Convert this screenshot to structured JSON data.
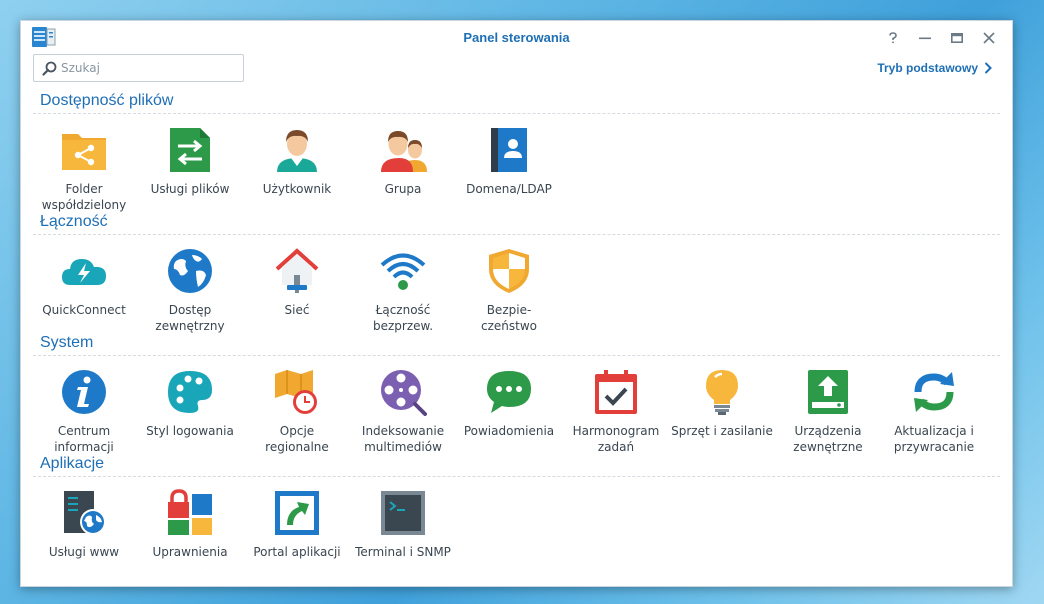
{
  "window": {
    "title": "Panel sterowania",
    "controls": [
      "help-icon",
      "minimize-icon",
      "maximize-icon",
      "close-icon"
    ]
  },
  "search": {
    "placeholder": "Szukaj",
    "value": ""
  },
  "mode_link": {
    "label": "Tryb podstawowy"
  },
  "colors": {
    "accent": "#1e6fb5",
    "text": "#3a4650"
  },
  "sections": {
    "file_sharing": {
      "title": "Dostępność plików",
      "items": [
        {
          "label": "Folder\nwspółdzielony",
          "icon": "shared-folder-icon"
        },
        {
          "label": "Usługi plików",
          "icon": "file-services-icon"
        },
        {
          "label": "Użytkownik",
          "icon": "user-icon"
        },
        {
          "label": "Grupa",
          "icon": "group-icon"
        },
        {
          "label": "Domena/LDAP",
          "icon": "domain-ldap-icon"
        }
      ]
    },
    "connectivity": {
      "title": "Łączność",
      "items": [
        {
          "label": "QuickConnect",
          "icon": "quickconnect-icon"
        },
        {
          "label": "Dostęp\nzewnętrzny",
          "icon": "external-access-icon"
        },
        {
          "label": "Sieć",
          "icon": "network-icon"
        },
        {
          "label": "Łączność\nbezprzew.",
          "icon": "wireless-icon"
        },
        {
          "label": "Bezpie-\nczeństwo",
          "icon": "security-shield-icon"
        }
      ]
    },
    "system": {
      "title": "System",
      "items": [
        {
          "label": "Centrum\ninformacji",
          "icon": "info-center-icon"
        },
        {
          "label": "Styl logowania",
          "icon": "palette-icon"
        },
        {
          "label": "Opcje\nregionalne",
          "icon": "regional-options-icon"
        },
        {
          "label": "Indeksowanie\nmultimediów",
          "icon": "media-indexing-icon"
        },
        {
          "label": "Powiadomienia",
          "icon": "notification-icon"
        },
        {
          "label": "Harmonogram\nzadań",
          "icon": "task-scheduler-icon"
        },
        {
          "label": "Sprzęt i zasilanie",
          "icon": "hardware-power-icon"
        },
        {
          "label": "Urządzenia\nzewnętrzne",
          "icon": "external-devices-icon"
        },
        {
          "label": "Aktualizacja i\nprzywracanie",
          "icon": "update-restore-icon"
        }
      ]
    },
    "applications": {
      "title": "Aplikacje",
      "items": [
        {
          "label": "Usługi www",
          "icon": "web-services-icon"
        },
        {
          "label": "Uprawnienia",
          "icon": "privileges-icon"
        },
        {
          "label": "Portal aplikacji",
          "icon": "application-portal-icon"
        },
        {
          "label": "Terminal i SNMP",
          "icon": "terminal-snmp-icon"
        }
      ]
    }
  }
}
